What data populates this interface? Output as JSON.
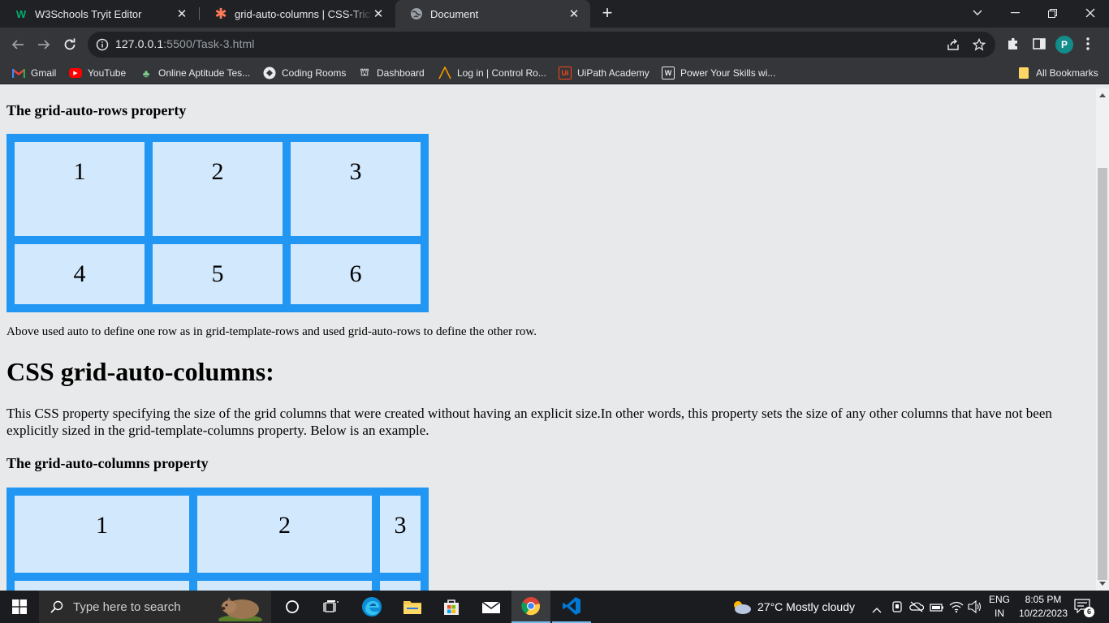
{
  "browser": {
    "tabs": [
      {
        "title": "W3Schools Tryit Editor",
        "favicon": "w3schools-logo",
        "active": false
      },
      {
        "title": "grid-auto-columns | CSS-Tricks - CSS-Tricks",
        "favicon": "css-tricks-asterisk",
        "active": false
      },
      {
        "title": "Document",
        "favicon": "globe-icon",
        "active": true
      }
    ],
    "url_host": "127.0.0.1",
    "url_path": ":5500/Task-3.html",
    "profile_initial": "P",
    "bookmarks": [
      {
        "label": "Gmail",
        "icon": "gmail-icon"
      },
      {
        "label": "YouTube",
        "icon": "youtube-icon"
      },
      {
        "label": "Online Aptitude Tes...",
        "icon": "aptitude-icon"
      },
      {
        "label": "Coding Rooms",
        "icon": "coding-rooms-icon"
      },
      {
        "label": "Dashboard",
        "icon": "dashboard-icon"
      },
      {
        "label": "Log in | Control Ro...",
        "icon": "control-room-icon"
      },
      {
        "label": "UiPath Academy",
        "icon": "uipath-icon"
      },
      {
        "label": "Power Your Skills wi...",
        "icon": "power-skills-icon"
      }
    ],
    "all_bookmarks": "All Bookmarks"
  },
  "page": {
    "heading_rows": "The grid-auto-rows property",
    "grid_rows_items": [
      "1",
      "2",
      "3",
      "4",
      "5",
      "6"
    ],
    "rows_note": "Above used auto to define one row as in grid-template-rows and used grid-auto-rows to define the other row.",
    "section_heading": "CSS grid-auto-columns:",
    "section_paragraph": "This CSS property specifying the size of the grid columns that were created without having an explicit size.In other words, this property sets the size of any other columns that have not been explicitly sized in the grid-template-columns property. Below is an example.",
    "heading_columns": "The grid-auto-columns property",
    "grid_columns_items": [
      "1",
      "2",
      "3"
    ]
  },
  "taskbar": {
    "search_placeholder": "Type here to search",
    "weather": "27°C  Mostly cloudy",
    "language_top": "ENG",
    "language_bottom": "IN",
    "time": "8:05 PM",
    "date": "10/22/2023",
    "notification_count": "6"
  },
  "colors": {
    "grid_border": "#2196f3",
    "grid_cell": "#d2e8fc",
    "page_bg": "#e8e9ea"
  }
}
